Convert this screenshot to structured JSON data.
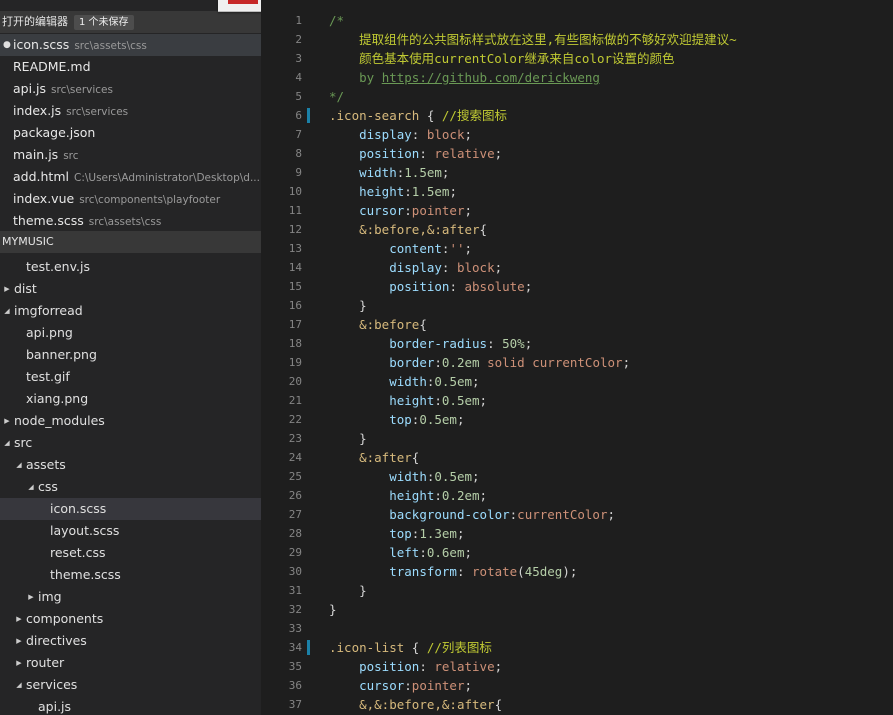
{
  "sidebar": {
    "open_editors_title": "打开的编辑器",
    "unsaved_badge": "1 个未保存",
    "open_editors": [
      {
        "name": "icon.scss",
        "path": "src\\assets\\css",
        "active": true,
        "dirty": true
      },
      {
        "name": "README.md",
        "path": ""
      },
      {
        "name": "api.js",
        "path": "src\\services"
      },
      {
        "name": "index.js",
        "path": "src\\services"
      },
      {
        "name": "package.json",
        "path": ""
      },
      {
        "name": "main.js",
        "path": "src"
      },
      {
        "name": "add.html",
        "path": "C:\\Users\\Administrator\\Desktop\\d..."
      },
      {
        "name": "index.vue",
        "path": "src\\components\\playfooter"
      },
      {
        "name": "theme.scss",
        "path": "src\\assets\\css"
      }
    ],
    "project_title": "MYMUSIC",
    "tree": [
      {
        "label": "test.env.js",
        "depth": 2,
        "twisty": "none"
      },
      {
        "label": "dist",
        "depth": 0,
        "twisty": "closed"
      },
      {
        "label": "imgforread",
        "depth": 0,
        "twisty": "open"
      },
      {
        "label": "api.png",
        "depth": 2,
        "twisty": "none"
      },
      {
        "label": "banner.png",
        "depth": 2,
        "twisty": "none"
      },
      {
        "label": "test.gif",
        "depth": 2,
        "twisty": "none"
      },
      {
        "label": "xiang.png",
        "depth": 2,
        "twisty": "none"
      },
      {
        "label": "node_modules",
        "depth": 0,
        "twisty": "closed"
      },
      {
        "label": "src",
        "depth": 0,
        "twisty": "open"
      },
      {
        "label": "assets",
        "depth": 1,
        "twisty": "open"
      },
      {
        "label": "css",
        "depth": 2,
        "twisty": "open"
      },
      {
        "label": "icon.scss",
        "depth": 4,
        "twisty": "none",
        "active": true
      },
      {
        "label": "layout.scss",
        "depth": 4,
        "twisty": "none"
      },
      {
        "label": "reset.css",
        "depth": 4,
        "twisty": "none"
      },
      {
        "label": "theme.scss",
        "depth": 4,
        "twisty": "none"
      },
      {
        "label": "img",
        "depth": 2,
        "twisty": "closed"
      },
      {
        "label": "components",
        "depth": 1,
        "twisty": "closed"
      },
      {
        "label": "directives",
        "depth": 1,
        "twisty": "closed"
      },
      {
        "label": "router",
        "depth": 1,
        "twisty": "closed"
      },
      {
        "label": "services",
        "depth": 1,
        "twisty": "open"
      },
      {
        "label": "api.js",
        "depth": 3,
        "twisty": "none"
      }
    ]
  },
  "editor": {
    "lines": [
      {
        "n": "1",
        "tokens": [
          [
            "cm",
            "/*"
          ]
        ]
      },
      {
        "n": "2",
        "tokens": [
          [
            "cmc",
            "    提取组件的公共图标样式放在这里,有些图标做的不够好欢迎提建议~"
          ]
        ]
      },
      {
        "n": "3",
        "tokens": [
          [
            "cmc",
            "    颜色基本使用currentColor继承来自color设置的颜色"
          ]
        ]
      },
      {
        "n": "4",
        "tokens": [
          [
            "cm",
            "    by "
          ],
          [
            "link",
            "https://github.com/derickweng"
          ]
        ]
      },
      {
        "n": "5",
        "tokens": [
          [
            "cm",
            "*/"
          ]
        ]
      },
      {
        "n": "6",
        "mark": true,
        "tokens": [
          [
            "sel",
            ".icon-search"
          ],
          [
            "p",
            " { "
          ],
          [
            "cmc",
            "//搜索图标"
          ]
        ]
      },
      {
        "n": "7",
        "tokens": [
          [
            "p",
            "    "
          ],
          [
            "prop",
            "display"
          ],
          [
            "p",
            ": "
          ],
          [
            "val",
            "block"
          ],
          [
            "p",
            ";"
          ]
        ]
      },
      {
        "n": "8",
        "tokens": [
          [
            "p",
            "    "
          ],
          [
            "prop",
            "position"
          ],
          [
            "p",
            ": "
          ],
          [
            "val",
            "relative"
          ],
          [
            "p",
            ";"
          ]
        ]
      },
      {
        "n": "9",
        "tokens": [
          [
            "p",
            "    "
          ],
          [
            "prop",
            "width"
          ],
          [
            "p",
            ":"
          ],
          [
            "num",
            "1.5em"
          ],
          [
            "p",
            ";"
          ]
        ]
      },
      {
        "n": "10",
        "tokens": [
          [
            "p",
            "    "
          ],
          [
            "prop",
            "height"
          ],
          [
            "p",
            ":"
          ],
          [
            "num",
            "1.5em"
          ],
          [
            "p",
            ";"
          ]
        ]
      },
      {
        "n": "11",
        "tokens": [
          [
            "p",
            "    "
          ],
          [
            "prop",
            "cursor"
          ],
          [
            "p",
            ":"
          ],
          [
            "val",
            "pointer"
          ],
          [
            "p",
            ";"
          ]
        ]
      },
      {
        "n": "12",
        "tokens": [
          [
            "p",
            "    "
          ],
          [
            "sel",
            "&:before,&:after"
          ],
          [
            "p",
            "{"
          ]
        ]
      },
      {
        "n": "13",
        "tokens": [
          [
            "p",
            "        "
          ],
          [
            "prop",
            "content"
          ],
          [
            "p",
            ":"
          ],
          [
            "val",
            "''"
          ],
          [
            "p",
            ";"
          ]
        ]
      },
      {
        "n": "14",
        "tokens": [
          [
            "p",
            "        "
          ],
          [
            "prop",
            "display"
          ],
          [
            "p",
            ": "
          ],
          [
            "val",
            "block"
          ],
          [
            "p",
            ";"
          ]
        ]
      },
      {
        "n": "15",
        "tokens": [
          [
            "p",
            "        "
          ],
          [
            "prop",
            "position"
          ],
          [
            "p",
            ": "
          ],
          [
            "val",
            "absolute"
          ],
          [
            "p",
            ";"
          ]
        ]
      },
      {
        "n": "16",
        "tokens": [
          [
            "p",
            "    }"
          ]
        ]
      },
      {
        "n": "17",
        "tokens": [
          [
            "p",
            "    "
          ],
          [
            "sel",
            "&:before"
          ],
          [
            "p",
            "{"
          ]
        ]
      },
      {
        "n": "18",
        "tokens": [
          [
            "p",
            "        "
          ],
          [
            "prop",
            "border-radius"
          ],
          [
            "p",
            ": "
          ],
          [
            "num",
            "50%"
          ],
          [
            "p",
            ";"
          ]
        ]
      },
      {
        "n": "19",
        "tokens": [
          [
            "p",
            "        "
          ],
          [
            "prop",
            "border"
          ],
          [
            "p",
            ":"
          ],
          [
            "num",
            "0.2em"
          ],
          [
            "p",
            " "
          ],
          [
            "val",
            "solid"
          ],
          [
            "p",
            " "
          ],
          [
            "val",
            "currentColor"
          ],
          [
            "p",
            ";"
          ]
        ]
      },
      {
        "n": "20",
        "tokens": [
          [
            "p",
            "        "
          ],
          [
            "prop",
            "width"
          ],
          [
            "p",
            ":"
          ],
          [
            "num",
            "0.5em"
          ],
          [
            "p",
            ";"
          ]
        ]
      },
      {
        "n": "21",
        "tokens": [
          [
            "p",
            "        "
          ],
          [
            "prop",
            "height"
          ],
          [
            "p",
            ":"
          ],
          [
            "num",
            "0.5em"
          ],
          [
            "p",
            ";"
          ]
        ]
      },
      {
        "n": "22",
        "tokens": [
          [
            "p",
            "        "
          ],
          [
            "prop",
            "top"
          ],
          [
            "p",
            ":"
          ],
          [
            "num",
            "0.5em"
          ],
          [
            "p",
            ";"
          ]
        ]
      },
      {
        "n": "23",
        "tokens": [
          [
            "p",
            "    }"
          ]
        ]
      },
      {
        "n": "24",
        "tokens": [
          [
            "p",
            "    "
          ],
          [
            "sel",
            "&:after"
          ],
          [
            "p",
            "{"
          ]
        ]
      },
      {
        "n": "25",
        "tokens": [
          [
            "p",
            "        "
          ],
          [
            "prop",
            "width"
          ],
          [
            "p",
            ":"
          ],
          [
            "num",
            "0.5em"
          ],
          [
            "p",
            ";"
          ]
        ]
      },
      {
        "n": "26",
        "tokens": [
          [
            "p",
            "        "
          ],
          [
            "prop",
            "height"
          ],
          [
            "p",
            ":"
          ],
          [
            "num",
            "0.2em"
          ],
          [
            "p",
            ";"
          ]
        ]
      },
      {
        "n": "27",
        "tokens": [
          [
            "p",
            "        "
          ],
          [
            "prop",
            "background-color"
          ],
          [
            "p",
            ":"
          ],
          [
            "val",
            "currentColor"
          ],
          [
            "p",
            ";"
          ]
        ]
      },
      {
        "n": "28",
        "tokens": [
          [
            "p",
            "        "
          ],
          [
            "prop",
            "top"
          ],
          [
            "p",
            ":"
          ],
          [
            "num",
            "1.3em"
          ],
          [
            "p",
            ";"
          ]
        ]
      },
      {
        "n": "29",
        "tokens": [
          [
            "p",
            "        "
          ],
          [
            "prop",
            "left"
          ],
          [
            "p",
            ":"
          ],
          [
            "num",
            "0.6em"
          ],
          [
            "p",
            ";"
          ]
        ]
      },
      {
        "n": "30",
        "tokens": [
          [
            "p",
            "        "
          ],
          [
            "prop",
            "transform"
          ],
          [
            "p",
            ": "
          ],
          [
            "val",
            "rotate"
          ],
          [
            "p",
            "("
          ],
          [
            "num",
            "45deg"
          ],
          [
            "p",
            ");"
          ]
        ]
      },
      {
        "n": "31",
        "tokens": [
          [
            "p",
            "    }"
          ]
        ]
      },
      {
        "n": "32",
        "tokens": [
          [
            "p",
            "}"
          ]
        ]
      },
      {
        "n": "33",
        "tokens": []
      },
      {
        "n": "34",
        "mark": true,
        "tokens": [
          [
            "sel",
            ".icon-list"
          ],
          [
            "p",
            " { "
          ],
          [
            "cmc",
            "//列表图标"
          ]
        ]
      },
      {
        "n": "35",
        "tokens": [
          [
            "p",
            "    "
          ],
          [
            "prop",
            "position"
          ],
          [
            "p",
            ": "
          ],
          [
            "val",
            "relative"
          ],
          [
            "p",
            ";"
          ]
        ]
      },
      {
        "n": "36",
        "tokens": [
          [
            "p",
            "    "
          ],
          [
            "prop",
            "cursor"
          ],
          [
            "p",
            ":"
          ],
          [
            "val",
            "pointer"
          ],
          [
            "p",
            ";"
          ]
        ]
      },
      {
        "n": "37",
        "tokens": [
          [
            "p",
            "    "
          ],
          [
            "sel",
            "&,&:before,&:after"
          ],
          [
            "p",
            "{"
          ]
        ]
      }
    ]
  }
}
